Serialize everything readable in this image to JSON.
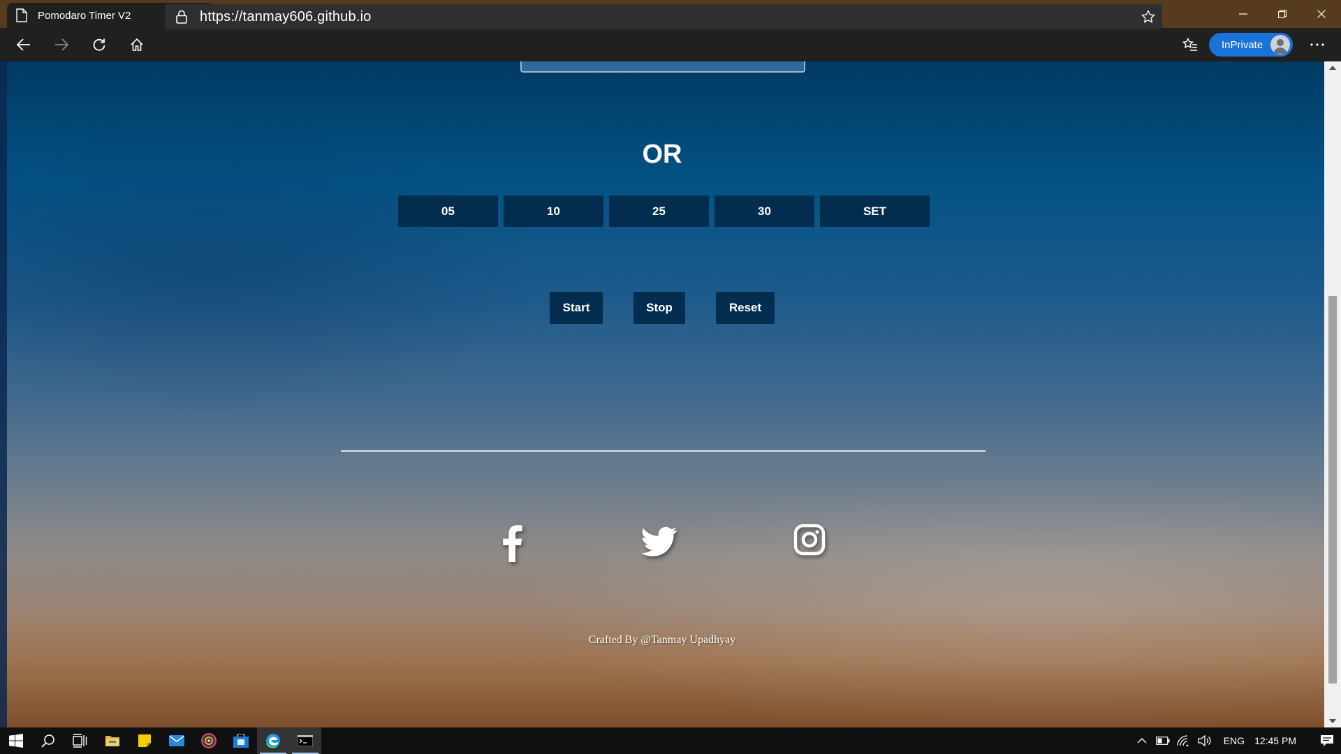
{
  "browser": {
    "tab_title": "Pomodaro Timer V2",
    "url": "https://tanmay606.github.io",
    "inprivate_label": "InPrivate"
  },
  "page": {
    "or_heading": "OR",
    "presets": [
      {
        "label": "05"
      },
      {
        "label": "10"
      },
      {
        "label": "25"
      },
      {
        "label": "30"
      },
      {
        "label": "SET"
      }
    ],
    "controls": {
      "start": "Start",
      "stop": "Stop",
      "reset": "Reset"
    },
    "social": [
      "facebook-icon",
      "twitter-icon",
      "instagram-icon"
    ],
    "credit": "Crafted By @Tanmay Upadhyay"
  },
  "taskbar": {
    "language": "ENG",
    "time": "12:45 PM"
  },
  "colors": {
    "button_bg": "#022d4f",
    "titlebar": "#563b1e",
    "inprivate": "#1a73d9"
  }
}
